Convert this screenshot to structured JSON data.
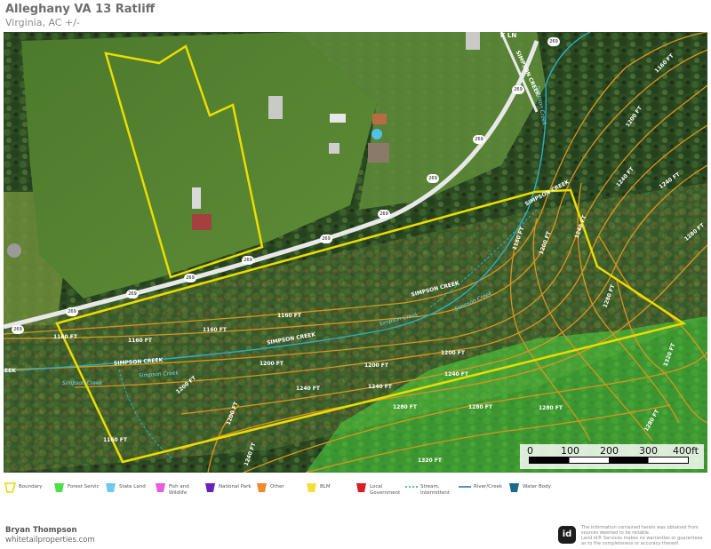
{
  "header": {
    "title": "Alleghany VA 13 Ratliff",
    "subtitle": "Virginia,  AC +/-"
  },
  "map": {
    "road_labels": [
      "K LN",
      "SIMPSON CREEK"
    ],
    "route_shields": [
      "269",
      "269",
      "269",
      "269",
      "269",
      "269",
      "269",
      "269",
      "269",
      "269",
      "269"
    ],
    "stream_labels": [
      "SIMPSON CREEK",
      "Simpson Creek",
      "SIMPSON CREEK",
      "Simpson Creek",
      "Simpson Creek",
      "SIMPSON CREEK",
      "Simpson Creek",
      "Simpson Creek",
      "EEK",
      "SIMPSON CREEK"
    ],
    "contour_labels": [
      "1160 FT",
      "1160 FT",
      "1160 FT",
      "1160 FT",
      "1200 FT",
      "1200 FT",
      "1200 FT",
      "1240 FT",
      "1240 FT",
      "1240 FT",
      "1280 FT",
      "1280 FT",
      "1320 FT",
      "1160 FT",
      "1200 FT",
      "1240 FT",
      "1280 FT",
      "1320 FT",
      "1160 FT",
      "1200 FT",
      "1240 FT",
      "1280 FT",
      "1200 FT",
      "1240 FT",
      "1280 FT",
      "1160 FT",
      "1200 FT",
      "1240 FT",
      "1280 FT"
    ],
    "scale_ticks": [
      "0",
      "100",
      "200",
      "300",
      "400ft"
    ]
  },
  "legend": [
    {
      "label": "Boundary",
      "color": "#e6d800",
      "icon": "boundary-icon"
    },
    {
      "label": "Forest Servic",
      "color": "#4de04a",
      "icon": "forest-service-icon"
    },
    {
      "label": "State Land",
      "color": "#6fc9ef",
      "icon": "state-land-icon"
    },
    {
      "label": "Fish and Wildlife",
      "color": "#e85ce0",
      "icon": "fish-wildlife-icon"
    },
    {
      "label": "National Park",
      "color": "#6a22b8",
      "icon": "national-park-icon"
    },
    {
      "label": "Other",
      "color": "#f08a2a",
      "icon": "other-icon"
    },
    {
      "label": "BLM",
      "color": "#f2e03a",
      "icon": "blm-icon"
    },
    {
      "label": "Local Government",
      "color": "#d91e28",
      "icon": "local-government-icon"
    },
    {
      "label": "Stream, Intermittent",
      "color": "#2a9ab5",
      "icon": "stream-intermittent-icon"
    },
    {
      "label": "River/Creek",
      "color": "#1f6fa8",
      "icon": "river-creek-icon"
    },
    {
      "label": "Water Body",
      "color": "#1a6a8a",
      "icon": "water-body-icon"
    }
  ],
  "footer": {
    "name": "Bryan Thompson",
    "website": "whitetailproperties.com",
    "logo": "id",
    "disclaimer": [
      "The information contained herein was obtained from",
      "sources deemed to be reliable.",
      "Land id® Services makes no warranties or guarantees",
      "as to the completeness or accuracy thereof."
    ]
  },
  "colors": {
    "boundary": "#e6d800",
    "contour": "#d9951e",
    "stream": "#29b0c9",
    "road": "#f5f5f5",
    "forest_service_overlay": "#57d44a"
  }
}
